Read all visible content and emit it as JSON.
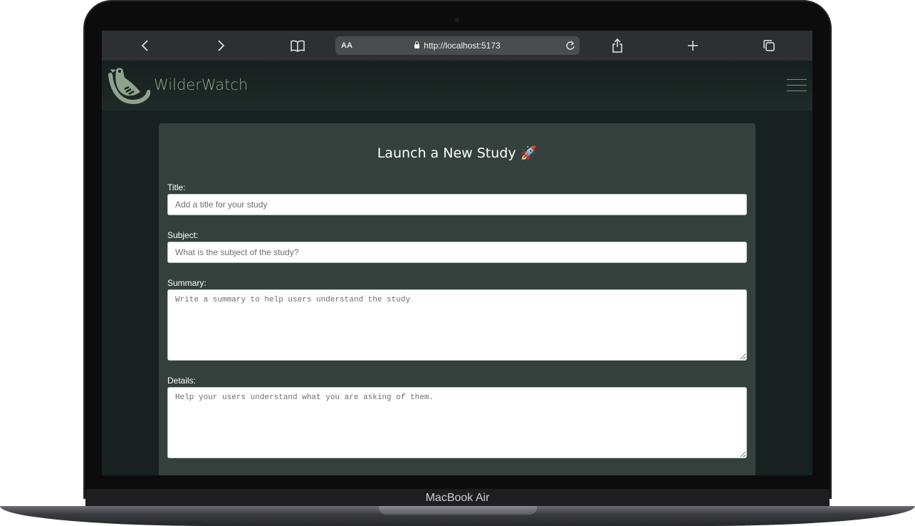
{
  "device": {
    "label": "MacBook Air"
  },
  "browser": {
    "text_size_label": "AA",
    "url": "http://localhost:5173",
    "icons": [
      "back-icon",
      "forward-icon",
      "bookmarks-icon",
      "reload-icon",
      "share-icon",
      "new-tab-icon",
      "tabs-icon"
    ]
  },
  "app": {
    "brand": "WilderWatch",
    "menu_icon": "hamburger-icon"
  },
  "form": {
    "heading": "Launch a New Study",
    "heading_emoji": "🚀",
    "fields": {
      "title": {
        "label": "Title:",
        "value": "",
        "placeholder": "Add a title for your study"
      },
      "subject": {
        "label": "Subject:",
        "value": "",
        "placeholder": "What is the subject of the study?"
      },
      "summary": {
        "label": "Summary:",
        "value": "",
        "placeholder": "Write a summary to help users understand the study"
      },
      "details": {
        "label": "Details:",
        "value": "",
        "placeholder": "Help your users understand what you are asking of them."
      }
    }
  },
  "colors": {
    "page_bg": "#172220",
    "card_bg": "#33403b",
    "brand_text": "#8fa38c",
    "toolbar_bg": "#2d2f30"
  }
}
